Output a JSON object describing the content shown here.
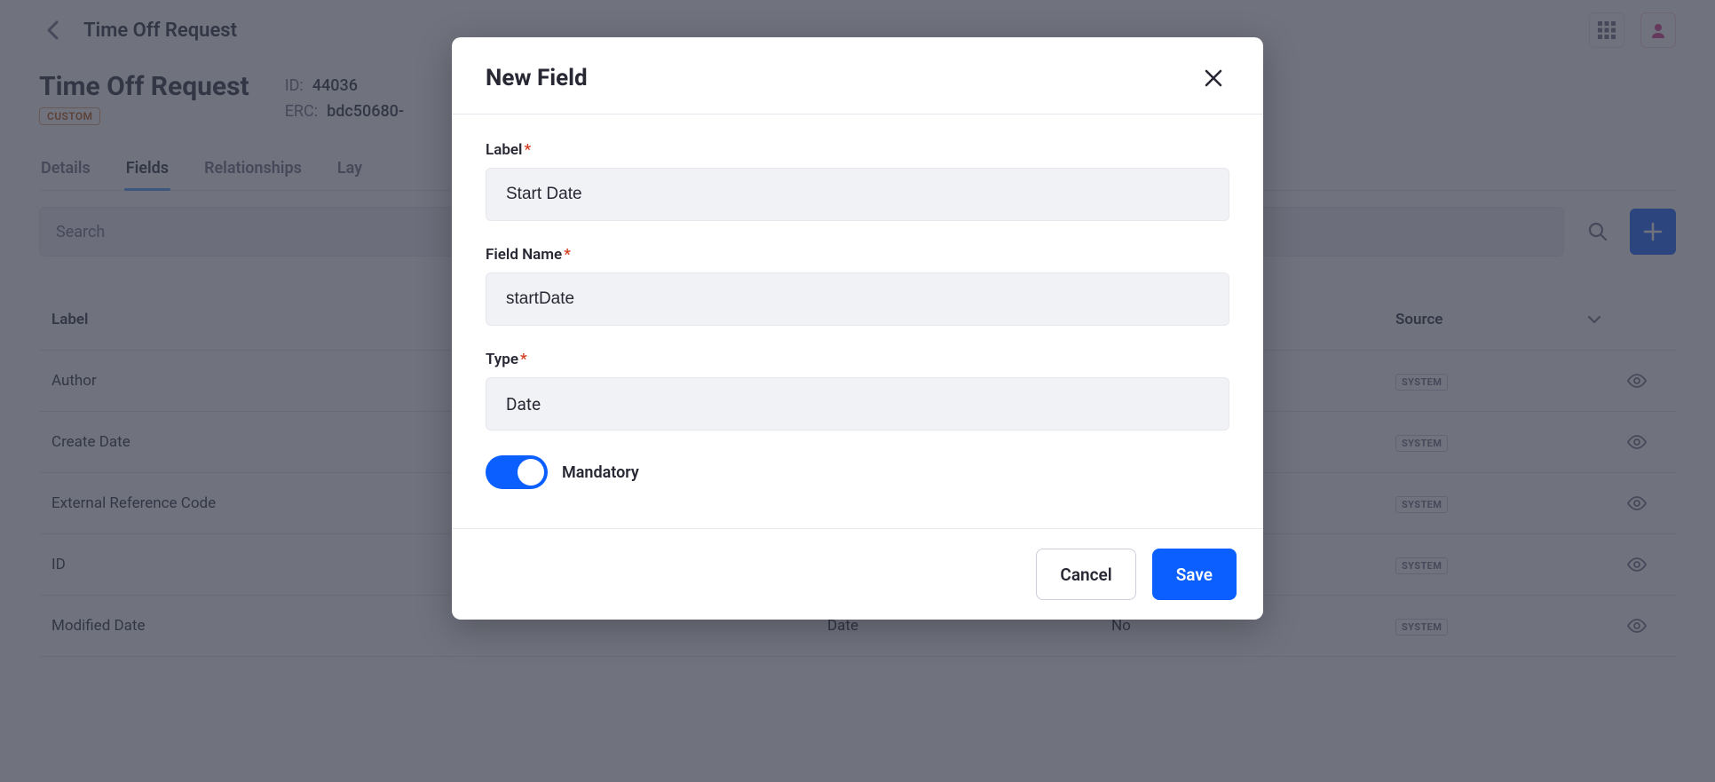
{
  "header": {
    "breadcrumb": "Time Off Request",
    "title": "Time Off Request",
    "badge": "CUSTOM",
    "meta": {
      "id_label": "ID:",
      "id_value": "44036",
      "erc_label": "ERC:",
      "erc_value": "bdc50680-"
    }
  },
  "tabs": [
    {
      "label": "Details"
    },
    {
      "label": "Fields"
    },
    {
      "label": "Relationships"
    },
    {
      "label": "Lay"
    }
  ],
  "active_tab_index": 1,
  "search": {
    "placeholder": "Search"
  },
  "table": {
    "headers": {
      "label": "Label",
      "type": "",
      "mandatory": "",
      "source": "Source"
    },
    "rows": [
      {
        "label": "Author",
        "type": "",
        "mandatory": "",
        "source": "SYSTEM"
      },
      {
        "label": "Create Date",
        "type": "",
        "mandatory": "",
        "source": "SYSTEM"
      },
      {
        "label": "External Reference Code",
        "type": "",
        "mandatory": "",
        "source": "SYSTEM"
      },
      {
        "label": "ID",
        "type": "",
        "mandatory": "",
        "source": "SYSTEM"
      },
      {
        "label": "Modified Date",
        "type": "Date",
        "mandatory": "No",
        "source": "SYSTEM"
      }
    ]
  },
  "modal": {
    "title": "New Field",
    "fields": {
      "label_label": "Label",
      "label_value": "Start Date",
      "name_label": "Field Name",
      "name_value": "startDate",
      "type_label": "Type",
      "type_value": "Date",
      "mandatory_label": "Mandatory",
      "mandatory_on": true
    },
    "buttons": {
      "cancel": "Cancel",
      "save": "Save"
    }
  },
  "colors": {
    "primary": "#0b5fff",
    "accent": "#4b9bff",
    "orange": "#b95000"
  }
}
